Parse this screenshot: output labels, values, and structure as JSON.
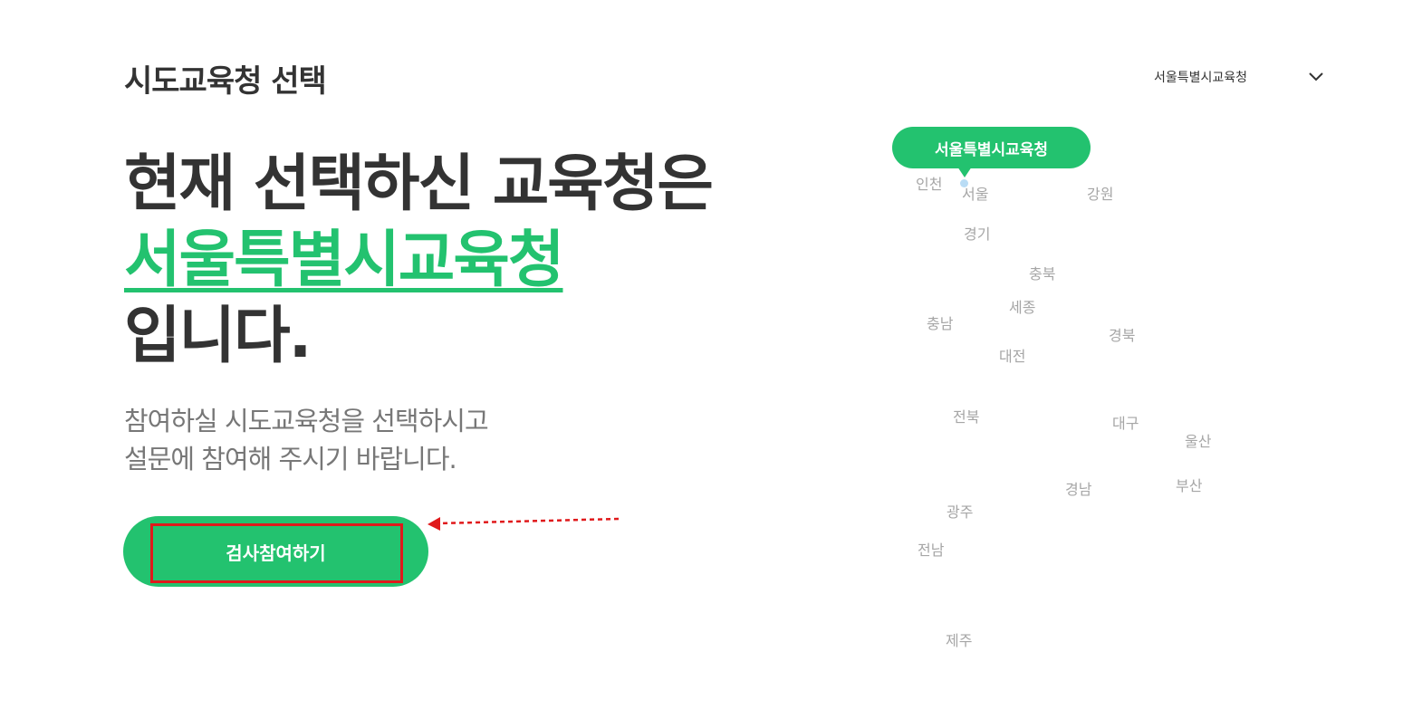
{
  "header": {
    "title": "시도교육청 선택",
    "region_select": {
      "selected": "서울특별시교육청",
      "icon": "chevron-down-icon"
    }
  },
  "main": {
    "headline": {
      "line1": "현재 선택하신 교육청은",
      "highlight": "서울특별시교육청",
      "line3": "입니다."
    },
    "description": {
      "line1": "참여하실 시도교육청을 선택하시고",
      "line2": "설문에 참여해 주시기 바랍니다."
    },
    "cta_label": "검사참여하기"
  },
  "map": {
    "tooltip": "서울특별시교육청",
    "regions": {
      "incheon": "인천",
      "seoul": "서울",
      "gangwon": "강원",
      "gyeonggi": "경기",
      "chungbuk": "충북",
      "sejong": "세종",
      "chungnam": "충남",
      "gyeongbuk": "경북",
      "daejeon": "대전",
      "jeonbuk": "전북",
      "daegu": "대구",
      "ulsan": "울산",
      "gyeongnam": "경남",
      "busan": "부산",
      "gwangju": "광주",
      "jeonnam": "전남",
      "jeju": "제주"
    }
  },
  "colors": {
    "accent": "#23c26f",
    "annotation": "#e0191b",
    "text": "#333333",
    "muted": "#777777",
    "region": "#a6a6a6"
  }
}
